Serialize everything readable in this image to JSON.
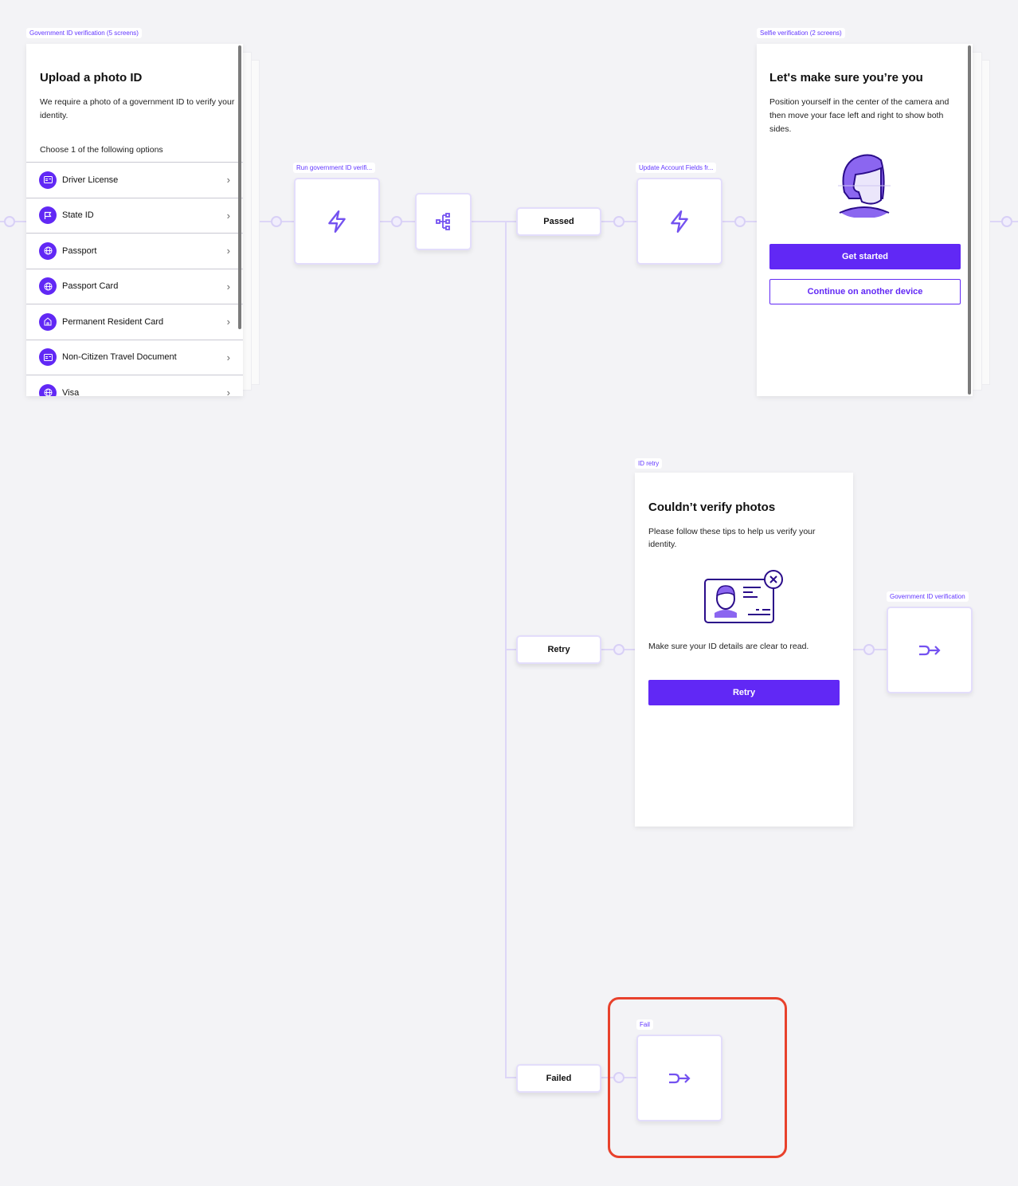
{
  "colors": {
    "accent": "#6128f5",
    "highlight": "#e8412c",
    "connector": "#ddd6f7"
  },
  "gov_id_screen": {
    "tag": "Government ID verification (5 screens)",
    "title": "Upload a photo ID",
    "description": "We require a photo of a government ID to verify your identity.",
    "choose_label": "Choose 1 of the following options",
    "options": [
      {
        "label": "Driver License",
        "icon": "id-card-icon"
      },
      {
        "label": "State ID",
        "icon": "flag-icon"
      },
      {
        "label": "Passport",
        "icon": "globe-icon"
      },
      {
        "label": "Passport Card",
        "icon": "globe-icon"
      },
      {
        "label": "Permanent Resident Card",
        "icon": "home-icon"
      },
      {
        "label": "Non-Citizen Travel Document",
        "icon": "id-card-icon"
      },
      {
        "label": "Visa",
        "icon": "globe-icon"
      }
    ]
  },
  "run_node": {
    "tag": "Run government ID verifi...",
    "icon": "lightning-icon"
  },
  "branch_node": {
    "icon": "branch-icon"
  },
  "branches": {
    "passed": "Passed",
    "retry": "Retry",
    "failed": "Failed"
  },
  "update_node": {
    "tag": "Update Account Fields fr...",
    "icon": "lightning-icon"
  },
  "selfie_screen": {
    "tag": "Selfie verification (2 screens)",
    "title": "Let's make sure you’re you",
    "description": "Position yourself in the center of the camera and then move your face left and right to show both sides.",
    "primary_button": "Get started",
    "secondary_button": "Continue on another device"
  },
  "retry_screen": {
    "tag": "ID retry",
    "title": "Couldn’t verify photos",
    "description": "Please follow these tips to help us verify your identity.",
    "tip": "Make sure your ID details are clear to read.",
    "button": "Retry"
  },
  "gov_id_goto": {
    "tag": "Government ID verification",
    "icon": "goto-arrow-icon"
  },
  "fail_node": {
    "tag": "Fail",
    "icon": "goto-arrow-icon"
  }
}
